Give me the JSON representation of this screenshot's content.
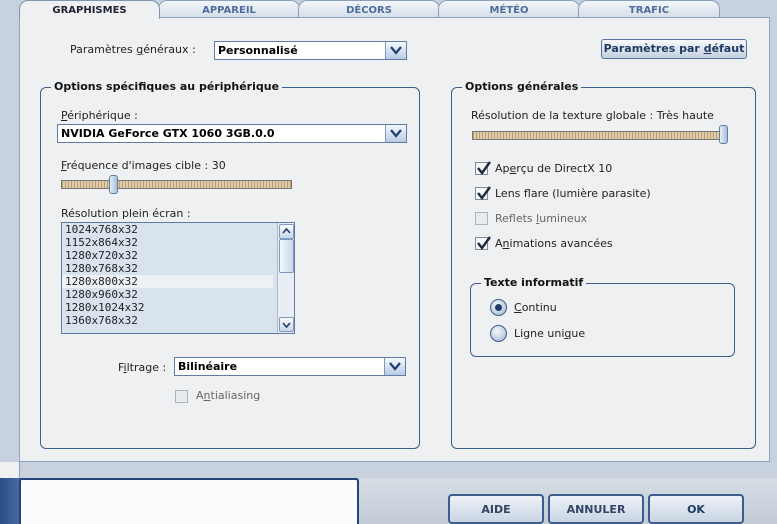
{
  "tabs": [
    {
      "label": "GRAPHISMES",
      "active": true
    },
    {
      "label": "APPAREIL",
      "active": false
    },
    {
      "label": "DÉCORS",
      "active": false
    },
    {
      "label": "MÉTÉO",
      "active": false
    },
    {
      "label": "TRAFIC",
      "active": false
    }
  ],
  "general": {
    "label_before": "Paramètres ",
    "label_u": "g",
    "label_after": "énéraux :",
    "value": "Personnalisé",
    "default_button": {
      "before": "Paramètres par ",
      "u": "d",
      "after": "éfaut"
    }
  },
  "device_group": {
    "title": "Options spécifiques au périphérique",
    "device_label": {
      "u": "P",
      "rest": "ériphérique :"
    },
    "device_value": "NVIDIA GeForce GTX 1060 3GB.0.0",
    "fps_label": {
      "u": "F",
      "rest": "réquence d'images cible : 30"
    },
    "fps_value": 30,
    "resolution_label": "Résolution plein écran :",
    "resolutions": [
      "1024x768x32",
      "1152x864x32",
      "1280x720x32",
      "1280x768x32",
      "1280x800x32",
      "1280x960x32",
      "1280x1024x32",
      "1360x768x32"
    ],
    "selected_resolution": "1280x800x32",
    "filter_label": {
      "before": "F",
      "u": "i",
      "after": "ltrage :"
    },
    "filter_value": "Bilinéaire",
    "antialiasing": {
      "before": "A",
      "u": "n",
      "after": "tialiasing",
      "checked": false
    }
  },
  "general_group": {
    "title": "Options générales",
    "texture_label": "Résolution de la texture globale : Très haute",
    "texture_level": 1.0,
    "checkboxes": [
      {
        "before": "Ap",
        "u": "e",
        "after": "rçu de DirectX 10",
        "checked": true
      },
      {
        "before": "Lens f",
        "u": "l",
        "after": "are (lumière parasite)",
        "checked": true
      },
      {
        "before": "Reflets ",
        "u": "l",
        "after": "umineux",
        "checked": false
      },
      {
        "before": "A",
        "u": "n",
        "after": "imations avancées",
        "checked": true
      }
    ]
  },
  "info_group": {
    "title": "Texte informatif",
    "options": [
      {
        "before": "",
        "u": "C",
        "after": "ontinu",
        "selected": true
      },
      {
        "before": "Ligne uni",
        "u": "q",
        "after": "ue",
        "selected": false
      }
    ]
  },
  "buttons": {
    "help": "AIDE",
    "cancel": "ANNULER",
    "ok": "OK"
  }
}
